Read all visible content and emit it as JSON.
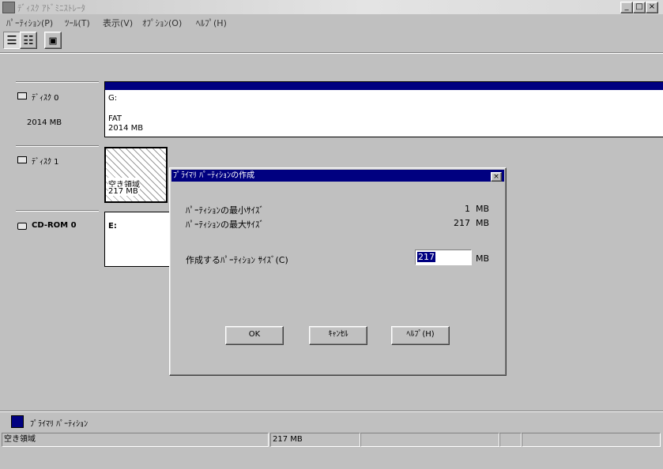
{
  "window": {
    "title": "ﾃﾞｨｽｸ ｱﾄﾞﾐﾆｽﾄﾚｰﾀ",
    "icons": {
      "app": "disk-admin-icon",
      "minimize": "minimize-icon",
      "maximize": "maximize-icon",
      "close": "close-icon"
    },
    "minimize_glyph": "_",
    "maximize_glyph": "□",
    "close_glyph": "×"
  },
  "menu": [
    {
      "label": "ﾊﾟｰﾃｨｼｮﾝ(P)"
    },
    {
      "label": "ﾂｰﾙ(T)"
    },
    {
      "label": "表示(V)"
    },
    {
      "label": "ｵﾌﾟｼｮﾝ(O)"
    },
    {
      "label": "ﾍﾙﾌﾟ(H)"
    }
  ],
  "toolbar": [
    {
      "name": "volumes-view-icon",
      "glyph": "☰"
    },
    {
      "name": "disk-configuration-view-icon",
      "glyph": "☷"
    },
    {
      "name": "properties-icon",
      "glyph": "▣"
    }
  ],
  "disks": [
    {
      "label": "ﾃﾞｨｽｸ 0",
      "size": "2014 MB",
      "icon": "hard-disk-icon",
      "partition": {
        "letter": "G:",
        "fs": "FAT",
        "size": "2014 MB"
      }
    },
    {
      "label": "ﾃﾞｨｽｸ 1",
      "size": "",
      "icon": "hard-disk-icon",
      "partition": {
        "letter": "",
        "fs": "空き領域",
        "size": "217 MB"
      }
    },
    {
      "label": "CD-ROM 0",
      "size": "",
      "icon": "cdrom-icon",
      "partition": {
        "letter": "E:",
        "fs": "",
        "size": ""
      }
    }
  ],
  "dialog": {
    "title": "ﾌﾟﾗｲﾏﾘ ﾊﾟｰﾃｨｼｮﾝの作成",
    "close_glyph": "×",
    "min_label": "ﾊﾟｰﾃｨｼｮﾝの最小ｻｲｽﾞ",
    "min_value": "1",
    "min_unit": "MB",
    "max_label": "ﾊﾟｰﾃｨｼｮﾝの最大ｻｲｽﾞ",
    "max_value": "217",
    "max_unit": "MB",
    "size_label": "作成するﾊﾟｰﾃｨｼｮﾝ ｻｲｽﾞ(C)",
    "size_value": "217",
    "size_unit": "MB",
    "ok": "OK",
    "cancel": "ｷｬﾝｾﾙ",
    "help": "ﾍﾙﾌﾟ(H)"
  },
  "legend": {
    "label": "ﾌﾟﾗｲﾏﾘ ﾊﾟｰﾃｨｼｮﾝ",
    "color": "#000080"
  },
  "status": {
    "type": "空き領域",
    "size": "217 MB"
  },
  "colors": {
    "primary_partition": "#000080",
    "dialog_title": "#000080"
  }
}
